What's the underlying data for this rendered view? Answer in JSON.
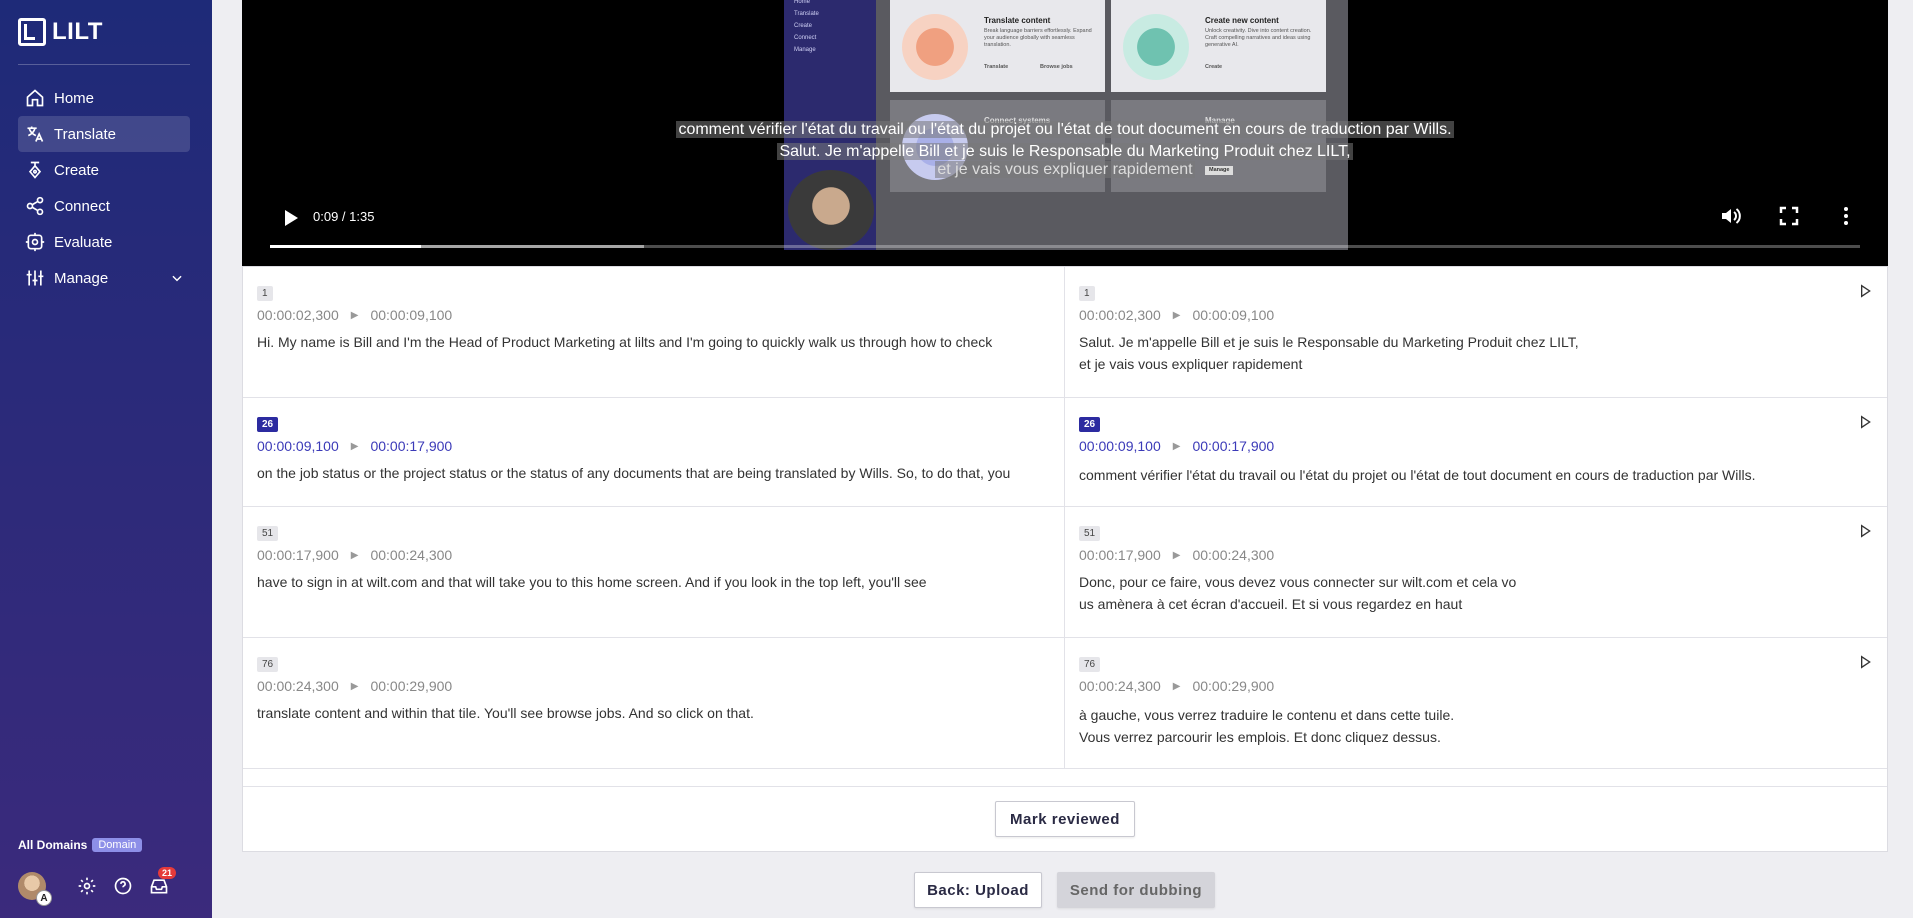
{
  "brand": {
    "name": "LILT"
  },
  "sidebar": {
    "items": [
      {
        "label": "Home",
        "icon": "home-icon"
      },
      {
        "label": "Translate",
        "icon": "translate-icon",
        "active": true
      },
      {
        "label": "Create",
        "icon": "pen-icon"
      },
      {
        "label": "Connect",
        "icon": "share-icon"
      },
      {
        "label": "Evaluate",
        "icon": "evaluate-icon"
      },
      {
        "label": "Manage",
        "icon": "sliders-icon",
        "expandable": true
      }
    ],
    "domain_label": "All Domains",
    "domain_badge": "Domain",
    "avatar_initial": "A",
    "notification_count": "21"
  },
  "video": {
    "thumbnail": {
      "side_items": [
        "Home",
        "Translate",
        "Create",
        "Connect",
        "Manage"
      ],
      "tiles": [
        {
          "title": "Translate content",
          "desc": "Break language barriers effortlessly. Expand your audience globally with seamless translation.",
          "buttons": [
            "Translate",
            "Browse jobs"
          ]
        },
        {
          "title": "Create new content",
          "desc": "Unlock creativity. Dive into content creation. Craft compelling narratives and ideas using generative AI.",
          "buttons": [
            "Create"
          ]
        },
        {
          "title": "Connect systems",
          "desc": "",
          "buttons": []
        },
        {
          "title": "Manage",
          "desc": "",
          "buttons": [
            "Manage"
          ]
        }
      ]
    },
    "subtitle_1": "comment vérifier l'état du travail ou l'état du projet ou l'état de tout document en cours de traduction par Wills.",
    "subtitle_2": "Salut. Je m'appelle Bill et je suis le Responsable du Marketing Produit chez LILT,",
    "subtitle_3": "et je vais vous expliquer rapidement",
    "time": "0:09 / 1:35",
    "played_fraction": 0.095,
    "buffered_fraction": 0.235
  },
  "segments": [
    {
      "id": "1",
      "active": false,
      "source": {
        "start": "00:00:02,300",
        "end": "00:00:09,100",
        "text": [
          "Hi. My name is Bill and I'm the Head of Product Marketing at lilts and I'm going to quickly walk us through how to check"
        ]
      },
      "target": {
        "start": "00:00:02,300",
        "end": "00:00:09,100",
        "text": [
          "Salut. Je m'appelle Bill et je suis le Responsable du Marketing Produit chez LILT,",
          "et je vais vous expliquer rapidement"
        ]
      }
    },
    {
      "id": "26",
      "active": true,
      "source": {
        "start": "00:00:09,100",
        "end": "00:00:17,900",
        "text": [
          "on the job status or the project status or the status of any documents that are being translated by Wills. So, to do that, you"
        ]
      },
      "target": {
        "start": "00:00:09,100",
        "end": "00:00:17,900",
        "text": [
          "comment vérifier l'état du travail ou l'état du projet ou l'état de tout document en cours de traduction par Wills."
        ]
      }
    },
    {
      "id": "51",
      "active": false,
      "source": {
        "start": "00:00:17,900",
        "end": "00:00:24,300",
        "text": [
          "have to sign in at wilt.com and that will take you to this home screen. And if you look in the top left, you'll see"
        ]
      },
      "target": {
        "start": "00:00:17,900",
        "end": "00:00:24,300",
        "text": [
          "Donc, pour ce faire, vous devez vous connecter sur wilt.com et cela vo",
          "us amènera à cet écran d'accueil. Et si vous regardez en haut"
        ]
      }
    },
    {
      "id": "76",
      "active": false,
      "source": {
        "start": "00:00:24,300",
        "end": "00:00:29,900",
        "text": [
          "translate content and within that tile. You'll see browse jobs. And so click on that."
        ]
      },
      "target": {
        "start": "00:00:24,300",
        "end": "00:00:29,900",
        "text": [
          "à gauche, vous verrez traduire le contenu et dans cette tuile.",
          "Vous verrez parcourir les emplois. Et donc cliquez dessus."
        ]
      }
    }
  ],
  "actions": {
    "mark_reviewed": "Mark reviewed",
    "back": "Back: Upload",
    "send": "Send for dubbing"
  }
}
